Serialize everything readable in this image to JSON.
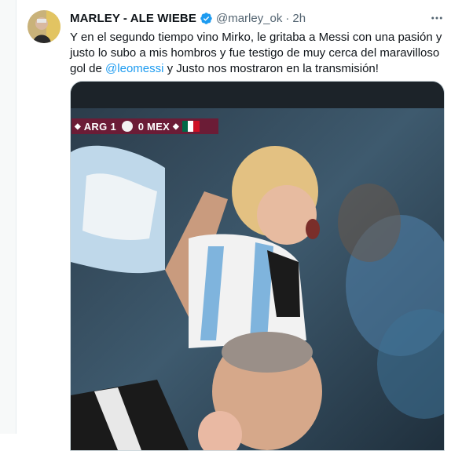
{
  "tweet": {
    "display_name": "MARLEY - ALE WIEBE",
    "handle": "@marley_ok",
    "separator": "·",
    "timestamp": "2h",
    "text_before": "Y en el segundo tiempo vino Mirko, le gritaba a Messi con una pasión y justo lo subo a mis hombros y fue testigo de muy cerca del maravilloso gol de ",
    "mention": "@leomessi",
    "text_after": " y Justo nos mostraron en la transmisión!"
  },
  "scoreboard": {
    "home_team": "ARG",
    "home_score": "1",
    "away_score": "0",
    "away_team": "MEX"
  },
  "colors": {
    "mention": "#1d9bf0",
    "verified": "#1d9bf0",
    "scoreboard_bg": "#6b1c36"
  },
  "icons": {
    "verified": "verified-badge-icon",
    "more": "more-options-icon"
  }
}
